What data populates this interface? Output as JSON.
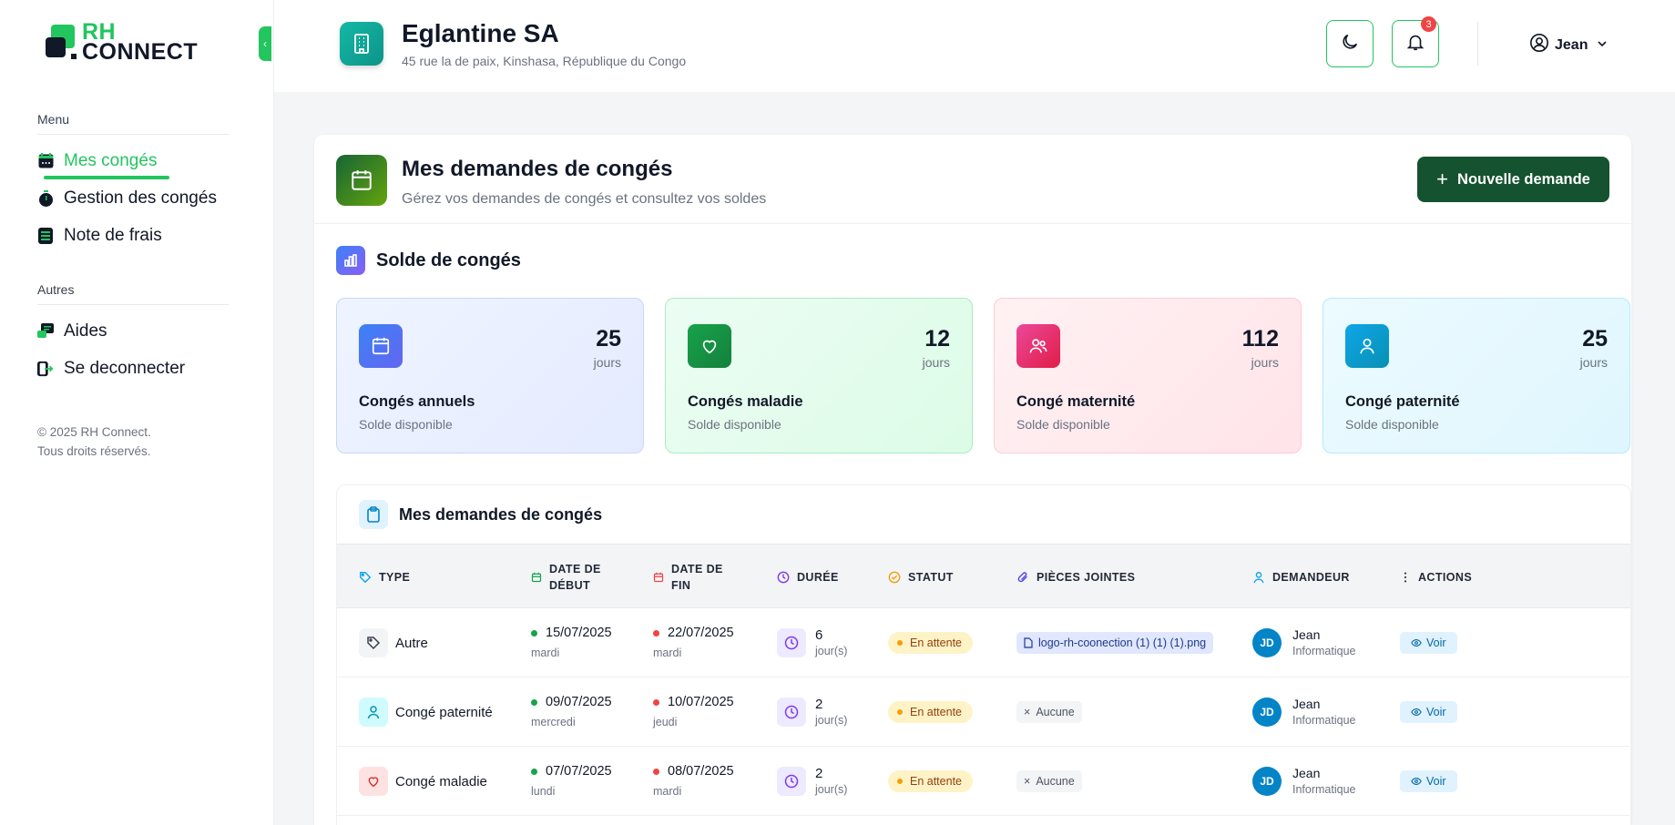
{
  "brand": {
    "line1": "RH",
    "line2": "CONNECT",
    "primary_color": "#22c55e",
    "dark_color": "#111827"
  },
  "sidebar": {
    "menu_heading": "Menu",
    "menu_items": [
      {
        "label": "Mes congés",
        "icon": "calendar-icon",
        "active": true
      },
      {
        "label": "Gestion des congés",
        "icon": "stopwatch-icon"
      },
      {
        "label": "Note de frais",
        "icon": "receipt-icon"
      }
    ],
    "other_heading": "Autres",
    "other_items": [
      {
        "label": "Aides",
        "icon": "help-chat-icon"
      },
      {
        "label": "Se deconnecter",
        "icon": "logout-icon"
      }
    ],
    "copyright_line1": "© 2025 RH Connect.",
    "copyright_line2": "Tous droits réservés."
  },
  "header": {
    "company_name": "Eglantine SA",
    "company_address": "45 rue la de paix, Kinshasa, République du Congo",
    "notification_count": "3",
    "user_name": "Jean"
  },
  "page": {
    "title": "Mes demandes de congés",
    "subtitle": "Gérez vos demandes de congés et consultez vos soldes",
    "new_request_label": "Nouvelle demande"
  },
  "balances": {
    "title": "Solde de congés",
    "cards": [
      {
        "value": "25",
        "unit": "jours",
        "title": "Congés annuels",
        "subtitle": "Solde disponible",
        "icon": "calendar-icon",
        "color": "#3b82f6"
      },
      {
        "value": "12",
        "unit": "jours",
        "title": "Congés maladie",
        "subtitle": "Solde disponible",
        "icon": "heart-icon",
        "color": "#16a34a"
      },
      {
        "value": "112",
        "unit": "jours",
        "title": "Congé maternité",
        "subtitle": "Solde disponible",
        "icon": "users-icon",
        "color": "#ec4899"
      },
      {
        "value": "25",
        "unit": "jours",
        "title": "Congé paternité",
        "subtitle": "Solde disponible",
        "icon": "user-icon",
        "color": "#0ea5e9"
      }
    ]
  },
  "requests": {
    "title": "Mes demandes de congés",
    "columns": {
      "type": "Type",
      "start": "Date de début",
      "end": "Date de fin",
      "duration": "Durée",
      "status": "Statut",
      "attachments": "Pièces jointes",
      "requester": "Demandeur",
      "actions": "Actions"
    },
    "rows": [
      {
        "type": "Autre",
        "type_icon": "tag-icon",
        "start_date": "15/07/2025",
        "start_day": "mardi",
        "end_date": "22/07/2025",
        "end_day": "mardi",
        "duration": "6",
        "duration_unit": "jour(s)",
        "status": "En attente",
        "attachment": "logo-rh-coonection (1) (1) (1).png",
        "requester_initials": "JD",
        "requester_name": "Jean",
        "requester_dept": "Informatique",
        "action": "Voir"
      },
      {
        "type": "Congé paternité",
        "type_icon": "user-icon",
        "start_date": "09/07/2025",
        "start_day": "mercredi",
        "end_date": "10/07/2025",
        "end_day": "jeudi",
        "duration": "2",
        "duration_unit": "jour(s)",
        "status": "En attente",
        "attachment": "Aucune",
        "requester_initials": "JD",
        "requester_name": "Jean",
        "requester_dept": "Informatique",
        "action": "Voir"
      },
      {
        "type": "Congé maladie",
        "type_icon": "heart-icon",
        "start_date": "07/07/2025",
        "start_day": "lundi",
        "end_date": "08/07/2025",
        "end_day": "mardi",
        "duration": "2",
        "duration_unit": "jour(s)",
        "status": "En attente",
        "attachment": "Aucune",
        "requester_initials": "JD",
        "requester_name": "Jean",
        "requester_dept": "Informatique",
        "action": "Voir"
      }
    ]
  }
}
